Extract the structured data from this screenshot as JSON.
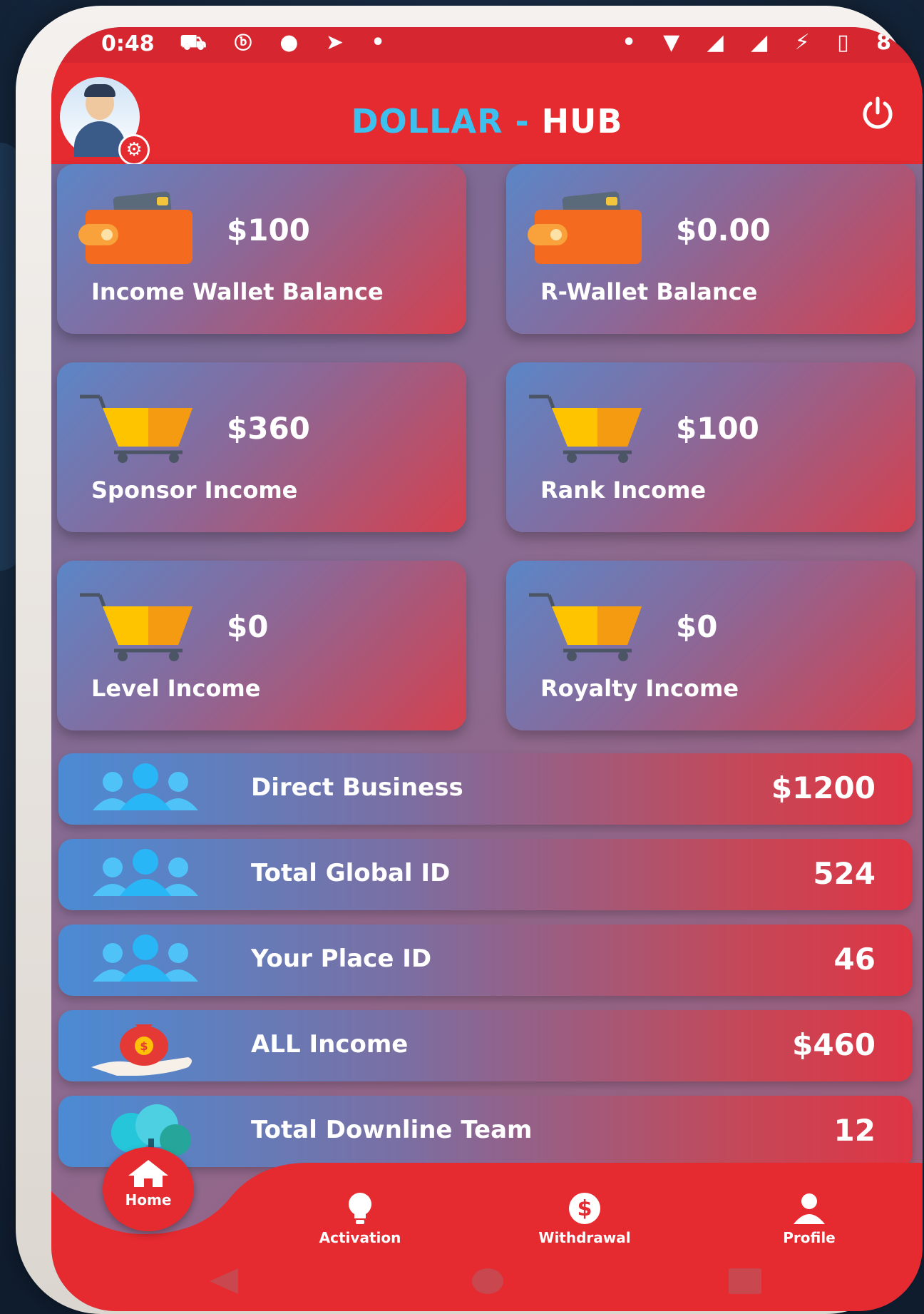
{
  "status_bar": {
    "time": "0:48",
    "left_icons": "⛟ ⓑ ● ➤ •",
    "right_icons": "• ▼ ◢ ◢ ⚡ ▯ 8"
  },
  "header": {
    "title_part1": "DOLLAR",
    "title_sep": " - ",
    "title_part2": "HUB"
  },
  "cards": [
    {
      "amount": "$100",
      "label": "Income Wallet Balance",
      "icon": "wallet-icon"
    },
    {
      "amount": "$0.00",
      "label": "R-Wallet Balance",
      "icon": "wallet-icon"
    },
    {
      "amount": "$360",
      "label": "Sponsor Income",
      "icon": "cart-icon"
    },
    {
      "amount": "$100",
      "label": "Rank Income",
      "icon": "cart-icon"
    },
    {
      "amount": "$0",
      "label": "Level Income",
      "icon": "cart-icon"
    },
    {
      "amount": "$0",
      "label": "Royalty Income",
      "icon": "cart-icon"
    }
  ],
  "rows": [
    {
      "label": "Direct Business",
      "value": "$1200",
      "icon": "users-icon"
    },
    {
      "label": "Total Global ID",
      "value": "524",
      "icon": "users-icon"
    },
    {
      "label": "Your Place ID",
      "value": "46",
      "icon": "users-icon"
    },
    {
      "label": "ALL Income",
      "value": "$460",
      "icon": "money-bag-icon"
    },
    {
      "label": "Total Downline Team",
      "value": "12",
      "icon": "tree-icon"
    }
  ],
  "bottom_nav": {
    "home": "Home",
    "activation": "Activation",
    "withdrawal": "Withdrawal",
    "profile": "Profile"
  },
  "colors": {
    "primary_red": "#e52a30",
    "accent_cyan": "#3ec0ef",
    "wallet_orange": "#f46b1f",
    "cart_yellow": "#ffc400"
  }
}
